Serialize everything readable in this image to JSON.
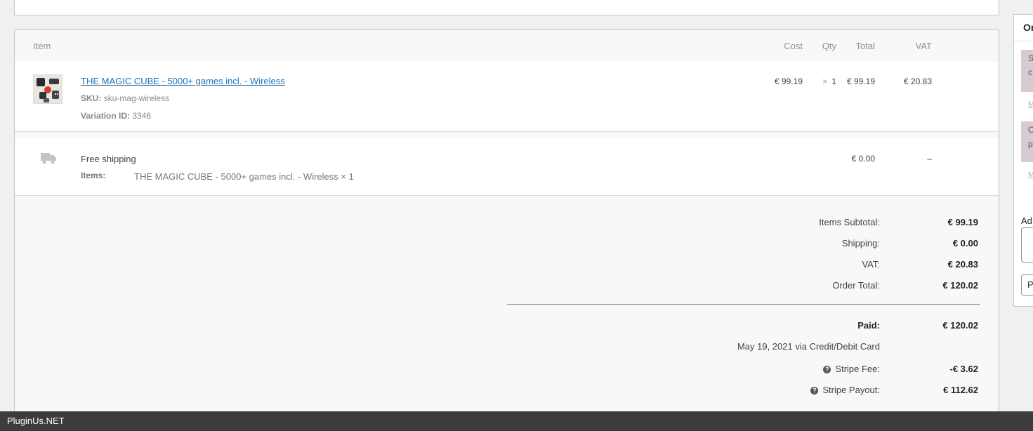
{
  "table": {
    "headers": {
      "item": "Item",
      "cost": "Cost",
      "qty": "Qty",
      "total": "Total",
      "vat": "VAT"
    },
    "product": {
      "name": "THE MAGIC CUBE - 5000+ games incl. - Wireless",
      "sku_label": "SKU:",
      "sku_value": "sku-mag-wireless",
      "variation_label": "Variation ID:",
      "variation_value": "3346",
      "cost": "€ 99.19",
      "qty_symbol": "×",
      "qty": "1",
      "total": "€ 99.19",
      "vat": "€ 20.83",
      "thumbnail_icon": "product-thumbnail"
    },
    "shipping": {
      "icon": "truck-icon",
      "name": "Free shipping",
      "items_label": "Items:",
      "items_value": "THE MAGIC CUBE - 5000+ games incl. - Wireless × 1",
      "total": "€ 0.00",
      "vat": "–"
    }
  },
  "totals": {
    "subtotal_label": "Items Subtotal:",
    "subtotal_value": "€ 99.19",
    "shipping_label": "Shipping:",
    "shipping_value": "€ 0.00",
    "vat_label": "VAT:",
    "vat_value": "€ 20.83",
    "order_total_label": "Order Total:",
    "order_total_value": "€ 120.02",
    "paid_label": "Paid:",
    "paid_value": "€ 120.02",
    "paid_date": "May 19, 2021 via Credit/Debit Card",
    "stripe_fee_label": "Stripe Fee:",
    "stripe_fee_value": "-€ 3.62",
    "stripe_payout_label": "Stripe Payout:",
    "stripe_payout_value": "€ 112.62",
    "help_glyph": "?"
  },
  "sidebar": {
    "title": "Or",
    "note1_text_a": "S",
    "note1_text_b": "c",
    "note1_link": "M",
    "note2_text_a": "C",
    "note2_text_b": "p",
    "note2_link": "M",
    "add_label": "Ad",
    "select_value": "P",
    "note_color": "#d7cad2"
  },
  "footer": {
    "text": "PluginUs.NET"
  },
  "colors": {
    "link": "#2271b1",
    "background": "#f0f0f1",
    "footer": "#3c3c3c"
  }
}
